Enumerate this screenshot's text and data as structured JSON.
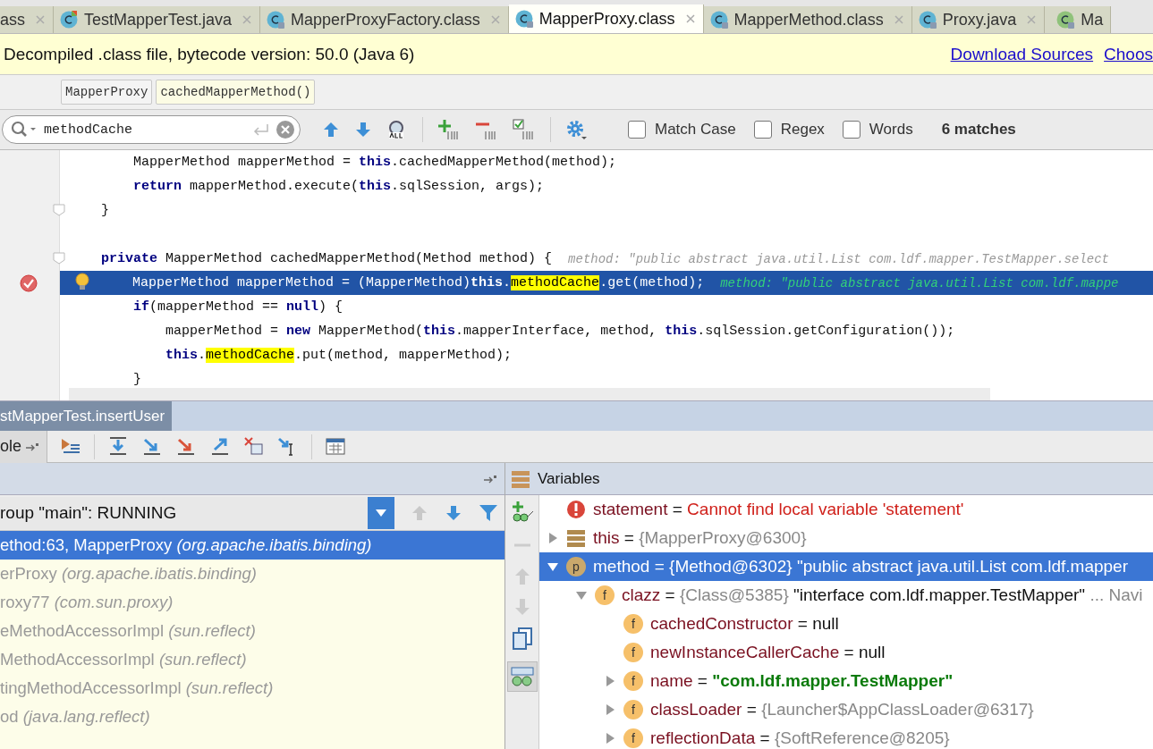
{
  "tabs": [
    {
      "label": "ass",
      "kind": "plain",
      "selected": false
    },
    {
      "label": "TestMapperTest.java",
      "kind": "test",
      "selected": false
    },
    {
      "label": "MapperProxyFactory.class",
      "kind": "class",
      "selected": false
    },
    {
      "label": "MapperProxy.class",
      "kind": "class",
      "selected": true
    },
    {
      "label": "MapperMethod.class",
      "kind": "class",
      "selected": false
    },
    {
      "label": "Proxy.java",
      "kind": "class",
      "selected": false
    },
    {
      "label": "Ma",
      "kind": "interface",
      "selected": false
    }
  ],
  "notice": {
    "text": "Decompiled .class file, bytecode version: 50.0 (Java 6)",
    "links": [
      "Download Sources",
      "Choos"
    ]
  },
  "breadcrumbs": [
    {
      "label": "MapperProxy",
      "selected": false
    },
    {
      "label": "cachedMapperMethod()",
      "selected": true
    }
  ],
  "search": {
    "value": "methodCache",
    "options": [
      {
        "label": "Match Case",
        "checked": false
      },
      {
        "label": "Regex",
        "checked": false
      },
      {
        "label": "Words",
        "checked": false
      }
    ],
    "matches": "6 matches"
  },
  "code": [
    {
      "fold": false,
      "breakpoint": false,
      "current": false,
      "segments": [
        {
          "kind": "plain",
          "text": "        MapperMethod mapperMethod = "
        },
        {
          "kind": "kw",
          "text": "this"
        },
        {
          "kind": "plain",
          "text": ".cachedMapperMethod(method);"
        }
      ]
    },
    {
      "fold": false,
      "breakpoint": false,
      "current": false,
      "segments": [
        {
          "kind": "kw",
          "text": "        return"
        },
        {
          "kind": "plain",
          "text": " mapperMethod.execute("
        },
        {
          "kind": "kw",
          "text": "this"
        },
        {
          "kind": "plain",
          "text": ".sqlSession, args);"
        }
      ]
    },
    {
      "fold": true,
      "breakpoint": false,
      "current": false,
      "segments": [
        {
          "kind": "plain",
          "text": "    }"
        }
      ]
    },
    {
      "fold": false,
      "breakpoint": false,
      "current": false
    },
    {
      "fold": true,
      "breakpoint": false,
      "current": false,
      "segments": [
        {
          "kind": "kw",
          "text": "    private"
        },
        {
          "kind": "plain",
          "text": " MapperMethod cachedMapperMethod(Method method) {  "
        },
        {
          "kind": "hint",
          "text": "method: \"public abstract java.util.List com.ldf.mapper.TestMapper.select"
        }
      ]
    },
    {
      "fold": false,
      "breakpoint": true,
      "current": true,
      "segments": [
        {
          "kind": "plain",
          "text": "        MapperMethod mapperMethod = (MapperMethod)"
        },
        {
          "kind": "kw",
          "text": "this"
        },
        {
          "kind": "plain",
          "text": "."
        },
        {
          "kind": "match",
          "text": "methodCache"
        },
        {
          "kind": "plain",
          "text": ".get(method);  "
        },
        {
          "kind": "hint",
          "text": "method: \"public abstract java.util.List com.ldf.mappe"
        }
      ]
    },
    {
      "fold": false,
      "breakpoint": false,
      "current": false,
      "segments": [
        {
          "kind": "kw",
          "text": "        if"
        },
        {
          "kind": "plain",
          "text": "(mapperMethod == "
        },
        {
          "kind": "kw",
          "text": "null"
        },
        {
          "kind": "plain",
          "text": ") {"
        }
      ]
    },
    {
      "fold": false,
      "breakpoint": false,
      "current": false,
      "segments": [
        {
          "kind": "plain",
          "text": "            mapperMethod = "
        },
        {
          "kind": "kw",
          "text": "new"
        },
        {
          "kind": "plain",
          "text": " MapperMethod("
        },
        {
          "kind": "kw",
          "text": "this"
        },
        {
          "kind": "plain",
          "text": ".mapperInterface, method, "
        },
        {
          "kind": "kw",
          "text": "this"
        },
        {
          "kind": "plain",
          "text": ".sqlSession.getConfiguration());"
        }
      ]
    },
    {
      "fold": false,
      "breakpoint": false,
      "current": false,
      "segments": [
        {
          "kind": "kw",
          "text": "            this"
        },
        {
          "kind": "plain",
          "text": "."
        },
        {
          "kind": "match",
          "text": "methodCache"
        },
        {
          "kind": "plain",
          "text": ".put(method, mapperMethod);"
        }
      ]
    },
    {
      "fold": false,
      "breakpoint": false,
      "current": false,
      "segments": [
        {
          "kind": "plain",
          "text": "        }"
        }
      ]
    }
  ],
  "debug": {
    "title": "stMapperTest.insertUser",
    "console_tab": "ole"
  },
  "frames": {
    "thread": "roup \"main\": RUNNING",
    "items": [
      {
        "method": "ethod:63, MapperProxy",
        "package": "(org.apache.ibatis.binding)",
        "selected": true
      },
      {
        "method": "erProxy",
        "package": "(org.apache.ibatis.binding)",
        "selected": false
      },
      {
        "method": "roxy77",
        "package": "(com.sun.proxy)",
        "selected": false
      },
      {
        "method": "eMethodAccessorImpl",
        "package": "(sun.reflect)",
        "selected": false
      },
      {
        "method": "MethodAccessorImpl",
        "package": "(sun.reflect)",
        "selected": false
      },
      {
        "method": "tingMethodAccessorImpl",
        "package": "(sun.reflect)",
        "selected": false
      },
      {
        "method": "od",
        "package": "(java.lang.reflect)",
        "selected": false
      }
    ]
  },
  "variables": {
    "title": "Variables",
    "items": [
      {
        "kind": "error",
        "name": "statement",
        "value": [
          {
            "kind": "plain",
            "text": "="
          },
          {
            "kind": "error",
            "text": "Cannot find local variable 'statement'"
          }
        ],
        "selected": false
      },
      {
        "kind": "object",
        "name": "this",
        "expanded": false,
        "value": [
          {
            "kind": "plain",
            "text": "="
          },
          {
            "kind": "ref",
            "text": "{MapperProxy@6300}"
          }
        ],
        "selected": false
      },
      {
        "kind": "param",
        "badge": "p",
        "name": "method",
        "expanded": true,
        "value": [
          {
            "kind": "plain",
            "text": "="
          },
          {
            "kind": "ref",
            "text": "{Method@6302}"
          },
          {
            "kind": "plain",
            "text": "\"public abstract java.util.List com.ldf.mapper"
          }
        ],
        "selected": true,
        "children": [
          {
            "kind": "field",
            "badge": "f",
            "name": "clazz",
            "expanded": true,
            "value": [
              {
                "kind": "plain",
                "text": "="
              },
              {
                "kind": "ref",
                "text": "{Class@5385}"
              },
              {
                "kind": "plain",
                "text": "\"interface com.ldf.mapper.TestMapper\""
              },
              {
                "kind": "ref",
                "text": "... Navi"
              }
            ],
            "selected": false,
            "children": [
              {
                "kind": "field",
                "badge": "f",
                "name": "cachedConstructor",
                "value": [
                  {
                    "kind": "plain",
                    "text": "="
                  },
                  {
                    "kind": "plain",
                    "text": "null"
                  }
                ],
                "selected": false
              },
              {
                "kind": "field",
                "badge": "f",
                "name": "newInstanceCallerCache",
                "value": [
                  {
                    "kind": "plain",
                    "text": "="
                  },
                  {
                    "kind": "plain",
                    "text": "null"
                  }
                ],
                "selected": false
              },
              {
                "kind": "field",
                "badge": "f",
                "name": "name",
                "expanded": false,
                "value": [
                  {
                    "kind": "plain",
                    "text": "="
                  },
                  {
                    "kind": "string",
                    "text": "\"com.ldf.mapper.TestMapper\""
                  }
                ],
                "selected": false
              },
              {
                "kind": "field",
                "badge": "f",
                "name": "classLoader",
                "expanded": false,
                "value": [
                  {
                    "kind": "plain",
                    "text": "="
                  },
                  {
                    "kind": "ref",
                    "text": "{Launcher$AppClassLoader@6317}"
                  }
                ],
                "selected": false
              },
              {
                "kind": "field",
                "badge": "f",
                "name": "reflectionData",
                "expanded": false,
                "value": [
                  {
                    "kind": "plain",
                    "text": "="
                  },
                  {
                    "kind": "ref",
                    "text": "{SoftReference@8205}"
                  }
                ],
                "selected": false
              }
            ]
          }
        ]
      }
    ]
  }
}
